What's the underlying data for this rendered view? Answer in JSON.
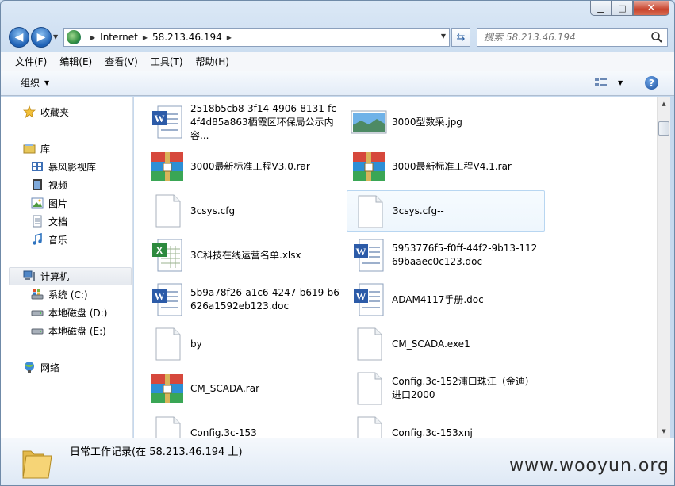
{
  "window": {
    "minimize": "▁",
    "maximize": "□",
    "close": "✕"
  },
  "address": {
    "segments": [
      "Internet",
      "58.213.46.194"
    ]
  },
  "search": {
    "placeholder": "搜索 58.213.46.194"
  },
  "menu": [
    "文件(F)",
    "编辑(E)",
    "查看(V)",
    "工具(T)",
    "帮助(H)"
  ],
  "toolbar": {
    "organize": "组织"
  },
  "nav": {
    "favorites": "收藏夹",
    "library": "库",
    "library_items": [
      "暴风影视库",
      "视频",
      "图片",
      "文档",
      "音乐"
    ],
    "computer": "计算机",
    "drives": [
      "系统 (C:)",
      "本地磁盘 (D:)",
      "本地磁盘 (E:)"
    ],
    "network": "网络"
  },
  "files": [
    {
      "name": "2518b5cb8-3f14-4906-8131-fc4f4d85a863栖霞区环保局公示内容...",
      "icon": "word-doc-icon"
    },
    {
      "name": "3000型数采.jpg",
      "icon": "image-thumbnail-icon"
    },
    {
      "name": "3000最新标准工程V3.0.rar",
      "icon": "winrar-archive-icon"
    },
    {
      "name": "3000最新标准工程V4.1.rar",
      "icon": "winrar-archive-icon"
    },
    {
      "name": "3csys.cfg",
      "icon": "blank-file-icon"
    },
    {
      "name": "3csys.cfg--",
      "icon": "blank-file-icon"
    },
    {
      "name": "3C科技在线运营名单.xlsx",
      "icon": "excel-sheet-icon"
    },
    {
      "name": "5953776f5-f0ff-44f2-9b13-11269baaec0c123.doc",
      "icon": "word-doc-icon"
    },
    {
      "name": "5b9a78f26-a1c6-4247-b619-b6626a1592eb123.doc",
      "icon": "word-doc-icon"
    },
    {
      "name": "ADAM4117手册.doc",
      "icon": "word-doc-icon"
    },
    {
      "name": "by",
      "icon": "blank-file-icon"
    },
    {
      "name": "CM_SCADA.exe1",
      "icon": "blank-file-icon"
    },
    {
      "name": "CM_SCADA.rar",
      "icon": "winrar-archive-icon"
    },
    {
      "name": "Config.3c-152浦口珠江（金迪）进口2000",
      "icon": "blank-file-icon"
    },
    {
      "name": "Config.3c-153",
      "icon": "blank-file-icon"
    },
    {
      "name": "Config.3c-153xnj",
      "icon": "blank-file-icon"
    }
  ],
  "details": {
    "title": "日常工作记录(在 58.213.46.194 上)"
  },
  "watermark": "www.wooyun.org"
}
